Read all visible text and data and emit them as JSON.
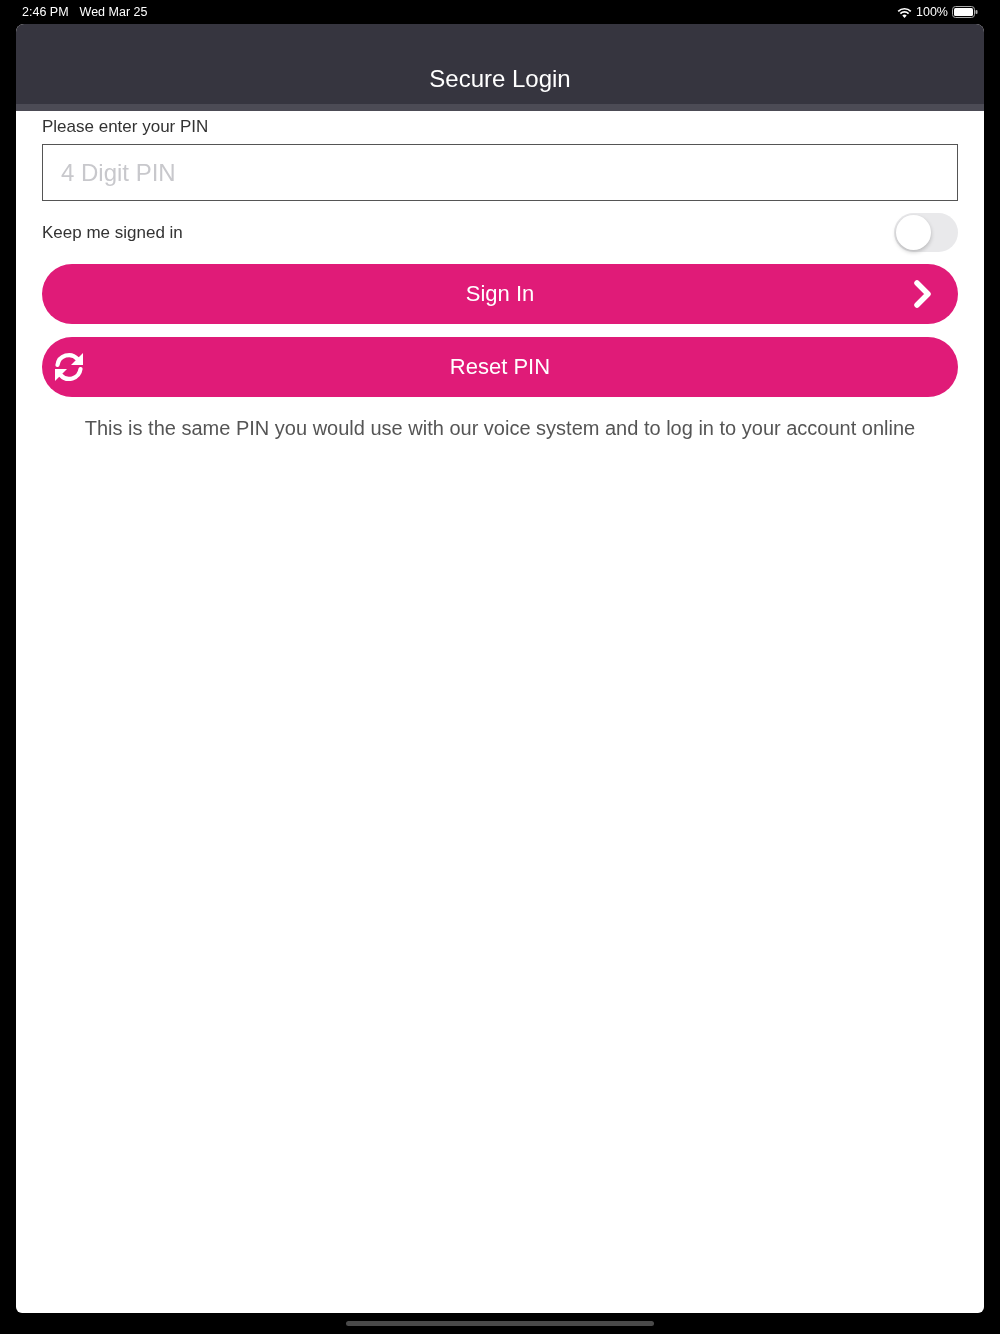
{
  "status_bar": {
    "time": "2:46 PM",
    "date": "Wed Mar 25",
    "battery": "100%"
  },
  "nav": {
    "title": "Secure Login"
  },
  "pin_field": {
    "label": "Please enter your PIN",
    "placeholder": "4 Digit PIN"
  },
  "keep_signed_in": {
    "label": "Keep me signed in",
    "on": false
  },
  "buttons": [
    {
      "kind": "sign-in",
      "label": "Sign In"
    },
    {
      "kind": "reset",
      "label": "Reset PIN"
    }
  ],
  "note": "This is the same PIN you would use with our voice system and to log in to your account online"
}
